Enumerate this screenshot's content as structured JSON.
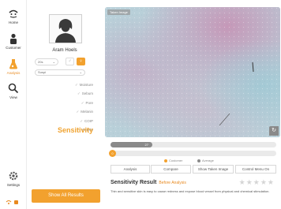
{
  "nav": {
    "items": [
      {
        "label": "Home",
        "icon": "home-robot-icon"
      },
      {
        "label": "Customer",
        "icon": "person-icon"
      },
      {
        "label": "Analysis",
        "icon": "flask-icon",
        "active": true
      },
      {
        "label": "View",
        "icon": "magnifier-icon"
      }
    ],
    "settings_label": "Settings"
  },
  "profile": {
    "name": "Aram Hoels",
    "age": "20s",
    "skin_type": "Suspi",
    "gender_selected": "female"
  },
  "categories": [
    "Moisture",
    "Sebum",
    "Pore",
    "Melanin",
    "COIP",
    "Wrinkle"
  ],
  "active_category": "Sensitivity",
  "show_all_label": "Show All Results",
  "image": {
    "tag": "Taken Image"
  },
  "sliders": {
    "customer_value": "27",
    "customer_fraction": 0.25,
    "knob_label": "0"
  },
  "legend": {
    "customer": "Customer",
    "average": "Average"
  },
  "tabs": [
    "Analysis",
    "Compare",
    "Show Taken Image",
    "Control Menu On"
  ],
  "result": {
    "title": "Sensitivity Result",
    "subtitle": "Before Analysis",
    "description": "Thin and sensitive skin is easy to cause redness and expose blood vessel from physical and chemical stimulation."
  },
  "colors": {
    "accent": "#f2a12e",
    "accent_dark": "#e8891f",
    "slider_fill": "#8a8a8a"
  }
}
